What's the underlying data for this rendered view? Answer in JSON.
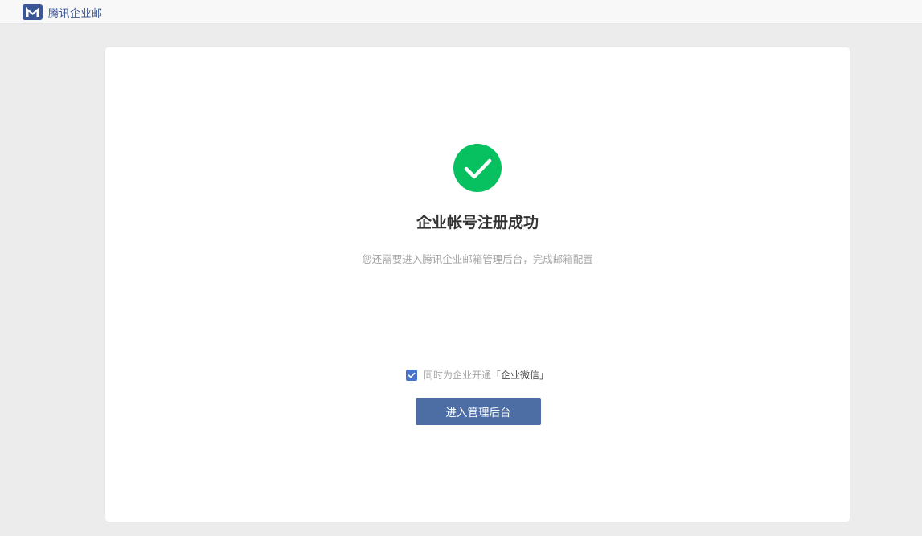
{
  "header": {
    "logo_icon": "tencent-exmail-logo-icon",
    "brand_name": "腾讯企业邮"
  },
  "main": {
    "success_icon": "check-circle-icon",
    "title": "企业帐号注册成功",
    "subtitle": "您还需要进入腾讯企业邮箱管理后台，完成邮箱配置",
    "option": {
      "checked": true,
      "label": "同时为企业开通",
      "highlight": "「企业微信」"
    },
    "enter_button_label": "进入管理后台"
  },
  "colors": {
    "brand": "#3b5694",
    "success": "#07c160",
    "button": "#4c6ea4",
    "checkbox": "#4a74c9",
    "page_background": "#ececec"
  }
}
